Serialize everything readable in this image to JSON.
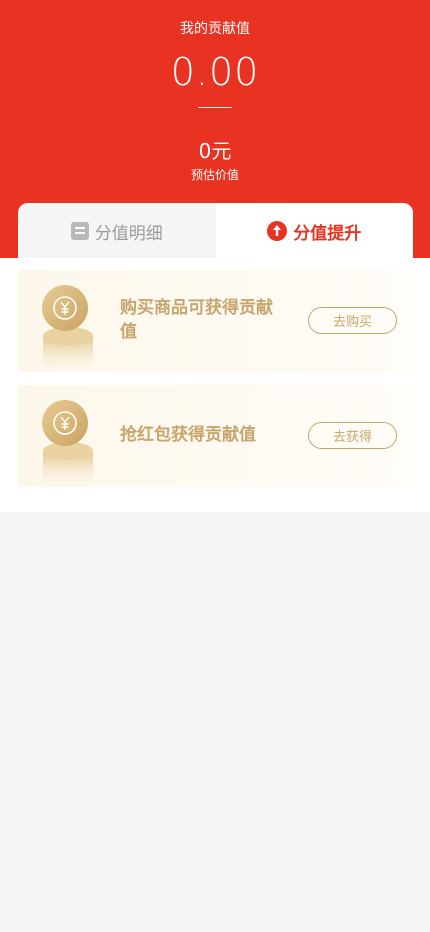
{
  "header": {
    "title": "我的贡献值",
    "value": "0.00",
    "money": "0元",
    "money_label": "预估价值"
  },
  "tabs": [
    {
      "label": "分值明细",
      "icon": "list-icon",
      "active": false
    },
    {
      "label": "分值提升",
      "icon": "arrow-up-circle-icon",
      "active": true
    }
  ],
  "tasks": [
    {
      "text": "购买商品可获得贡献值",
      "button": "去购买",
      "icon": "yuan-coin-icon"
    },
    {
      "text": "抢红包获得贡献值",
      "button": "去获得",
      "icon": "yuan-coin-icon"
    }
  ],
  "colors": {
    "primary": "#e83323",
    "gold": "#c8a56c",
    "background": "#f4f4f4"
  }
}
